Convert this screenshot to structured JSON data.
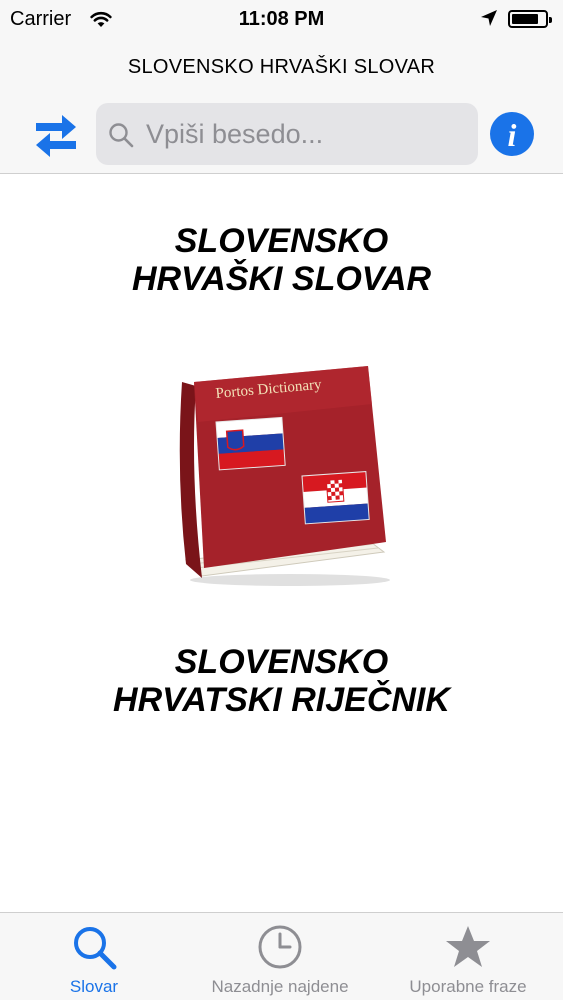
{
  "status_bar": {
    "carrier": "Carrier",
    "time": "11:08 PM"
  },
  "header": {
    "title": "SLOVENSKO HRVAŠKI SLOVAR",
    "search_placeholder": "Vpiši besedo...",
    "swap_icon": "swap-arrows-icon",
    "info_icon": "info-icon"
  },
  "main": {
    "heading_top_line1": "SLOVENSKO",
    "heading_top_line2": "HRVAŠKI SLOVAR",
    "book_title": "Portos Dictionary",
    "heading_bottom_line1": "SLOVENSKO",
    "heading_bottom_line2": "HRVATSKI RIJEČNIK"
  },
  "tabs": [
    {
      "label": "Slovar",
      "icon": "search-icon",
      "active": true
    },
    {
      "label": "Nazadnje najdene",
      "icon": "clock-icon",
      "active": false
    },
    {
      "label": "Uporabne fraze",
      "icon": "star-icon",
      "active": false
    }
  ],
  "colors": {
    "accent": "#1a73e8",
    "inactive": "#8e8e93",
    "book_red": "#a5222a",
    "bar_background": "#f7f7f7"
  }
}
